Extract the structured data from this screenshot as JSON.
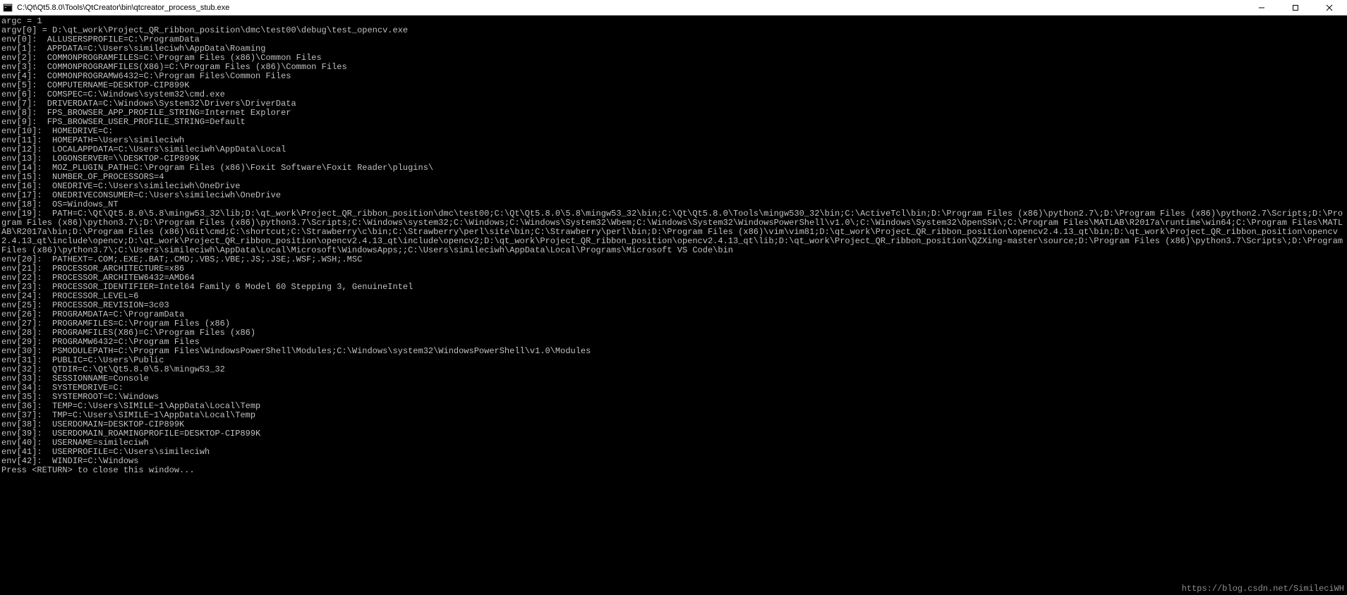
{
  "window": {
    "title": "C:\\Qt\\Qt5.8.0\\Tools\\QtCreator\\bin\\qtcreator_process_stub.exe"
  },
  "watermark": "https://blog.csdn.net/SimileciWH",
  "lines": [
    "argc = 1",
    "argv[0] = D:\\qt_work\\Project_QR_ribbon_position\\dmc\\test00\\debug\\test_opencv.exe",
    "env[0]:  ALLUSERSPROFILE=C:\\ProgramData",
    "env[1]:  APPDATA=C:\\Users\\simileciwh\\AppData\\Roaming",
    "env[2]:  COMMONPROGRAMFILES=C:\\Program Files (x86)\\Common Files",
    "env[3]:  COMMONPROGRAMFILES(X86)=C:\\Program Files (x86)\\Common Files",
    "env[4]:  COMMONPROGRAMW6432=C:\\Program Files\\Common Files",
    "env[5]:  COMPUTERNAME=DESKTOP-CIP899K",
    "env[6]:  COMSPEC=C:\\Windows\\system32\\cmd.exe",
    "env[7]:  DRIVERDATA=C:\\Windows\\System32\\Drivers\\DriverData",
    "env[8]:  FPS_BROWSER_APP_PROFILE_STRING=Internet Explorer",
    "env[9]:  FPS_BROWSER_USER_PROFILE_STRING=Default",
    "env[10]:  HOMEDRIVE=C:",
    "env[11]:  HOMEPATH=\\Users\\simileciwh",
    "env[12]:  LOCALAPPDATA=C:\\Users\\simileciwh\\AppData\\Local",
    "env[13]:  LOGONSERVER=\\\\DESKTOP-CIP899K",
    "env[14]:  MOZ_PLUGIN_PATH=C:\\Program Files (x86)\\Foxit Software\\Foxit Reader\\plugins\\",
    "env[15]:  NUMBER_OF_PROCESSORS=4",
    "env[16]:  ONEDRIVE=C:\\Users\\simileciwh\\OneDrive",
    "env[17]:  ONEDRIVECONSUMER=C:\\Users\\simileciwh\\OneDrive",
    "env[18]:  OS=Windows_NT",
    "env[19]:  PATH=C:\\Qt\\Qt5.8.0\\5.8\\mingw53_32\\lib;D:\\qt_work\\Project_QR_ribbon_position\\dmc\\test00;C:\\Qt\\Qt5.8.0\\5.8\\mingw53_32\\bin;C:\\Qt\\Qt5.8.0\\Tools\\mingw530_32\\bin;C:\\ActiveTcl\\bin;D:\\Program Files (x86)\\python2.7\\;D:\\Program Files (x86)\\python2.7\\Scripts;D:\\Program Files (x86)\\python3.7\\;D:\\Program Files (x86)\\python3.7\\Scripts;C:\\Windows\\system32;C:\\Windows;C:\\Windows\\System32\\Wbem;C:\\Windows\\System32\\WindowsPowerShell\\v1.0\\;C:\\Windows\\System32\\OpenSSH\\;C:\\Program Files\\MATLAB\\R2017a\\runtime\\win64;C:\\Program Files\\MATLAB\\R2017a\\bin;D:\\Program Files (x86)\\Git\\cmd;C:\\shortcut;C:\\Strawberry\\c\\bin;C:\\Strawberry\\perl\\site\\bin;C:\\Strawberry\\perl\\bin;D:\\Program Files (x86)\\vim\\vim81;D:\\qt_work\\Project_QR_ribbon_position\\opencv2.4.13_qt\\bin;D:\\qt_work\\Project_QR_ribbon_position\\opencv2.4.13_qt\\include\\opencv;D:\\qt_work\\Project_QR_ribbon_position\\opencv2.4.13_qt\\include\\opencv2;D:\\qt_work\\Project_QR_ribbon_position\\opencv2.4.13_qt\\lib;D:\\qt_work\\Project_QR_ribbon_position\\QZXing-master\\source;D:\\Program Files (x86)\\python3.7\\Scripts\\;D:\\Program Files (x86)\\python3.7\\;C:\\Users\\simileciwh\\AppData\\Local\\Microsoft\\WindowsApps;;C:\\Users\\simileciwh\\AppData\\Local\\Programs\\Microsoft VS Code\\bin",
    "env[20]:  PATHEXT=.COM;.EXE;.BAT;.CMD;.VBS;.VBE;.JS;.JSE;.WSF;.WSH;.MSC",
    "env[21]:  PROCESSOR_ARCHITECTURE=x86",
    "env[22]:  PROCESSOR_ARCHITEW6432=AMD64",
    "env[23]:  PROCESSOR_IDENTIFIER=Intel64 Family 6 Model 60 Stepping 3, GenuineIntel",
    "env[24]:  PROCESSOR_LEVEL=6",
    "env[25]:  PROCESSOR_REVISION=3c03",
    "env[26]:  PROGRAMDATA=C:\\ProgramData",
    "env[27]:  PROGRAMFILES=C:\\Program Files (x86)",
    "env[28]:  PROGRAMFILES(X86)=C:\\Program Files (x86)",
    "env[29]:  PROGRAMW6432=C:\\Program Files",
    "env[30]:  PSMODULEPATH=C:\\Program Files\\WindowsPowerShell\\Modules;C:\\Windows\\system32\\WindowsPowerShell\\v1.0\\Modules",
    "env[31]:  PUBLIC=C:\\Users\\Public",
    "env[32]:  QTDIR=C:\\Qt\\Qt5.8.0\\5.8\\mingw53_32",
    "env[33]:  SESSIONNAME=Console",
    "env[34]:  SYSTEMDRIVE=C:",
    "env[35]:  SYSTEMROOT=C:\\Windows",
    "env[36]:  TEMP=C:\\Users\\SIMILE~1\\AppData\\Local\\Temp",
    "env[37]:  TMP=C:\\Users\\SIMILE~1\\AppData\\Local\\Temp",
    "env[38]:  USERDOMAIN=DESKTOP-CIP899K",
    "env[39]:  USERDOMAIN_ROAMINGPROFILE=DESKTOP-CIP899K",
    "env[40]:  USERNAME=simileciwh",
    "env[41]:  USERPROFILE=C:\\Users\\simileciwh",
    "env[42]:  WINDIR=C:\\Windows",
    "Press <RETURN> to close this window..."
  ]
}
